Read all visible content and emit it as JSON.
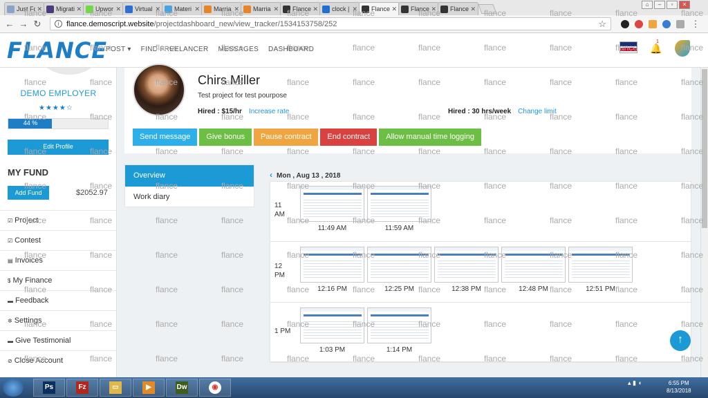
{
  "browser": {
    "tabs": [
      {
        "title": "Just Fo",
        "icon_color": "#8aa4c8",
        "icon": "doc-icon"
      },
      {
        "title": "Migrati",
        "icon_color": "#4a3b7a",
        "icon": "b-icon"
      },
      {
        "title": "Upwor",
        "icon_color": "#6fda44",
        "icon": "up-icon"
      },
      {
        "title": "Virtual",
        "icon_color": "#2f6fd1",
        "icon": "pen-icon"
      },
      {
        "title": "Materi",
        "icon_color": "#4aa3df",
        "icon": "chat-icon"
      },
      {
        "title": "Marria",
        "icon_color": "#e8832a",
        "icon": "ring-icon"
      },
      {
        "title": "Marria",
        "icon_color": "#e8832a",
        "icon": "ring-icon"
      },
      {
        "title": "Flance",
        "icon_color": "#333333",
        "icon": "flance-icon"
      },
      {
        "title": "clock |",
        "icon_color": "#1f6fd1",
        "icon": "clock-icon"
      },
      {
        "title": "Flance",
        "icon_color": "#333333",
        "icon": "flance-icon"
      },
      {
        "title": "Flance",
        "icon_color": "#333333",
        "icon": "flance-icon"
      },
      {
        "title": "Flance",
        "icon_color": "#333333",
        "icon": "flance-icon"
      }
    ],
    "url_host": "flance.demoscript.website",
    "url_path": "/projectdashboard_new/view_tracker/1534153758/252"
  },
  "header": {
    "logo": "FLANCE",
    "nav": [
      "POST ▾",
      "FIND FREELANCER",
      "MESSAGES",
      "DASHBOARD"
    ],
    "notification_count": "1",
    "language": "English"
  },
  "sidebar": {
    "name": "DEMO EMPLOYER",
    "rating_stars": "★★★★☆",
    "profile_progress": "44 %",
    "profile_progress_value": 0.44,
    "edit_profile": "Edit Profile",
    "fund_title": "MY FUND",
    "add_fund": "Add Fund",
    "balance": "$2052.97",
    "menu": [
      {
        "label": "Project",
        "icon": "checkbox-icon",
        "glyph": "☑"
      },
      {
        "label": "Contest",
        "icon": "checkbox-icon",
        "glyph": "☑"
      },
      {
        "label": "Invoices",
        "icon": "file-icon",
        "glyph": "▤"
      },
      {
        "label": "My Finance",
        "icon": "dollar-icon",
        "glyph": "$"
      },
      {
        "label": "Feedback",
        "icon": "comment-icon",
        "glyph": "▬"
      },
      {
        "label": "Settings",
        "icon": "gear-icon",
        "glyph": "✲"
      },
      {
        "label": "Give Testimonial",
        "icon": "comments-icon",
        "glyph": "▬"
      },
      {
        "label": "Close Account",
        "icon": "user-x-icon",
        "glyph": "⊘"
      }
    ]
  },
  "profile": {
    "name": "Chirs Miller",
    "project": "Test project for test pourpose",
    "hired_rate": "Hired : $15/hr",
    "increase_rate": "Increase rate",
    "hired_hours": "Hired : 30 hrs/week",
    "change_limit": "Change limit",
    "actions": [
      {
        "label": "Send message",
        "color": "#2db0e9"
      },
      {
        "label": "Give bonus",
        "color": "#6cbe44"
      },
      {
        "label": "Pause contract",
        "color": "#f0a640"
      },
      {
        "label": "End contract",
        "color": "#d9423f"
      },
      {
        "label": "Allow manual time logging",
        "color": "#6cbe44"
      }
    ]
  },
  "views": {
    "overview": "Overview",
    "work_diary": "Work diary"
  },
  "tracker": {
    "date": "Mon , Aug 13 , 2018",
    "rows": [
      {
        "hour": "11",
        "period": "AM",
        "shots": [
          "11:49 AM",
          "11:59 AM"
        ]
      },
      {
        "hour": "12",
        "period": "PM",
        "shots": [
          "12:16 PM",
          "12:25 PM",
          "12:38 PM",
          "12:48 PM",
          "12:51 PM"
        ]
      },
      {
        "hour": "1 PM",
        "period": "",
        "shots": [
          "1:03 PM",
          "1:14 PM"
        ]
      }
    ]
  },
  "taskbar": {
    "apps": [
      "Ps",
      "Fz",
      "▭",
      "▶",
      "Dw",
      "◉"
    ],
    "time": "6:55 PM",
    "date": "8/13/2018"
  },
  "watermark": "flance"
}
